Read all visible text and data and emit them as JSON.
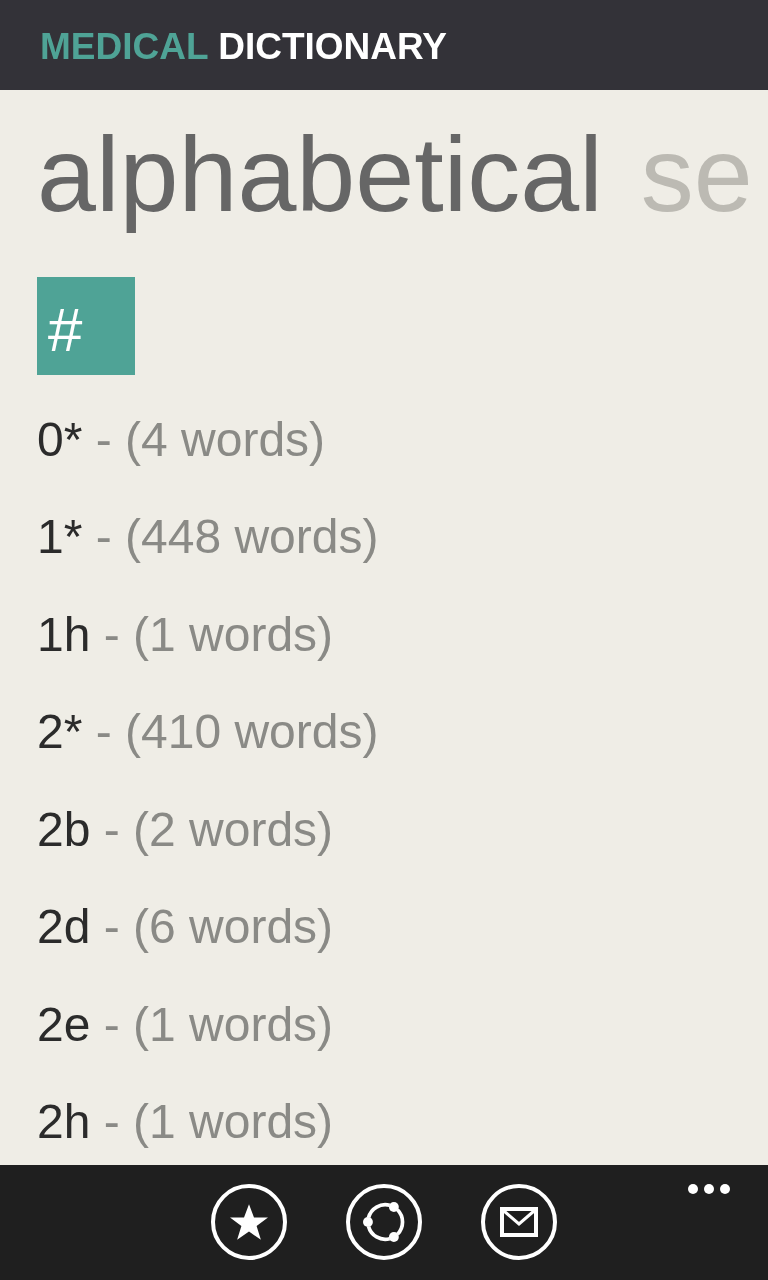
{
  "app_title": {
    "accent": "MEDICAL",
    "name": "DICTIONARY"
  },
  "pivot": [
    {
      "label": "alphabetical",
      "selected": true
    },
    {
      "label": "se",
      "selected": false
    }
  ],
  "group": {
    "header": "#"
  },
  "entries": [
    {
      "term": "0*",
      "detail": "- (4 words)"
    },
    {
      "term": "1*",
      "detail": "- (448 words)"
    },
    {
      "term": "1h",
      "detail": "- (1 words)"
    },
    {
      "term": "2*",
      "detail": "- (410 words)"
    },
    {
      "term": "2b",
      "detail": "- (2 words)"
    },
    {
      "term": "2d",
      "detail": "- (6 words)"
    },
    {
      "term": "2e",
      "detail": "- (1 words)"
    },
    {
      "term": "2h",
      "detail": "- (1 words)"
    }
  ],
  "app_bar": {
    "buttons": [
      {
        "kind": "favorite"
      },
      {
        "kind": "share"
      },
      {
        "kind": "email"
      }
    ]
  }
}
